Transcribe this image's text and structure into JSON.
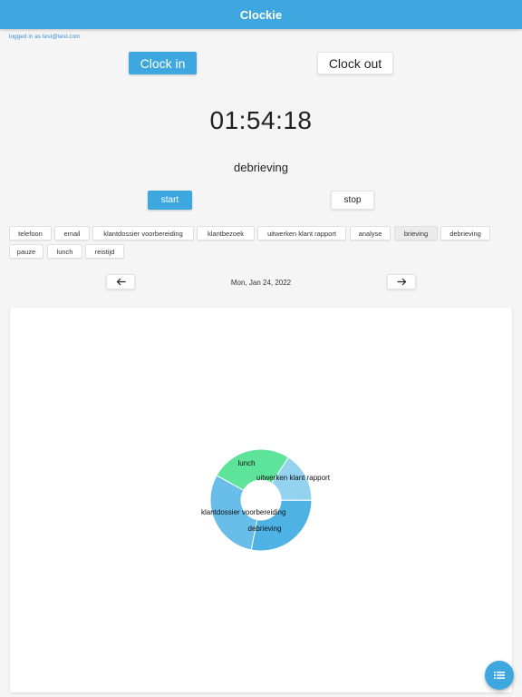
{
  "app": {
    "title": "Clockie",
    "logged_in": "logged in as test@test.com"
  },
  "clock": {
    "in_label": "Clock in",
    "out_label": "Clock out"
  },
  "timer": {
    "value": "01:54:18",
    "task": "debrieving",
    "start_label": "start",
    "stop_label": "stop"
  },
  "categories": [
    {
      "label": "telefoon",
      "selected": false
    },
    {
      "label": "email",
      "selected": false
    },
    {
      "label": "klantdossier voorbereiding",
      "selected": false
    },
    {
      "label": "klantbezoek",
      "selected": false
    },
    {
      "label": "uitwerken klant rapport",
      "selected": false
    },
    {
      "label": "analyse",
      "selected": false
    },
    {
      "label": "brieving",
      "selected": true
    },
    {
      "label": "debrieving",
      "selected": false
    },
    {
      "label": "pauze",
      "selected": false
    },
    {
      "label": "lunch",
      "selected": false
    },
    {
      "label": "reistijd",
      "selected": false
    }
  ],
  "date_nav": {
    "date": "Mon, Jan 24, 2022",
    "prev_icon": "arrow-left-icon",
    "next_icon": "arrow-right-icon"
  },
  "fab": {
    "icon": "list-icon"
  },
  "colors": {
    "accent": "#3ea7e0",
    "selected_chip": "#ebebeb"
  },
  "chart_data": {
    "type": "pie",
    "donut": true,
    "slices": [
      {
        "label": "uitwerken klant rapport",
        "value": 16,
        "color": "#93d3f0"
      },
      {
        "label": "debrieving",
        "value": 28,
        "color": "#4fb2e5"
      },
      {
        "label": "klantdossier voorbereiding",
        "value": 30,
        "color": "#68bde9"
      },
      {
        "label": "lunch",
        "value": 26,
        "color": "#5ee39a"
      }
    ]
  }
}
